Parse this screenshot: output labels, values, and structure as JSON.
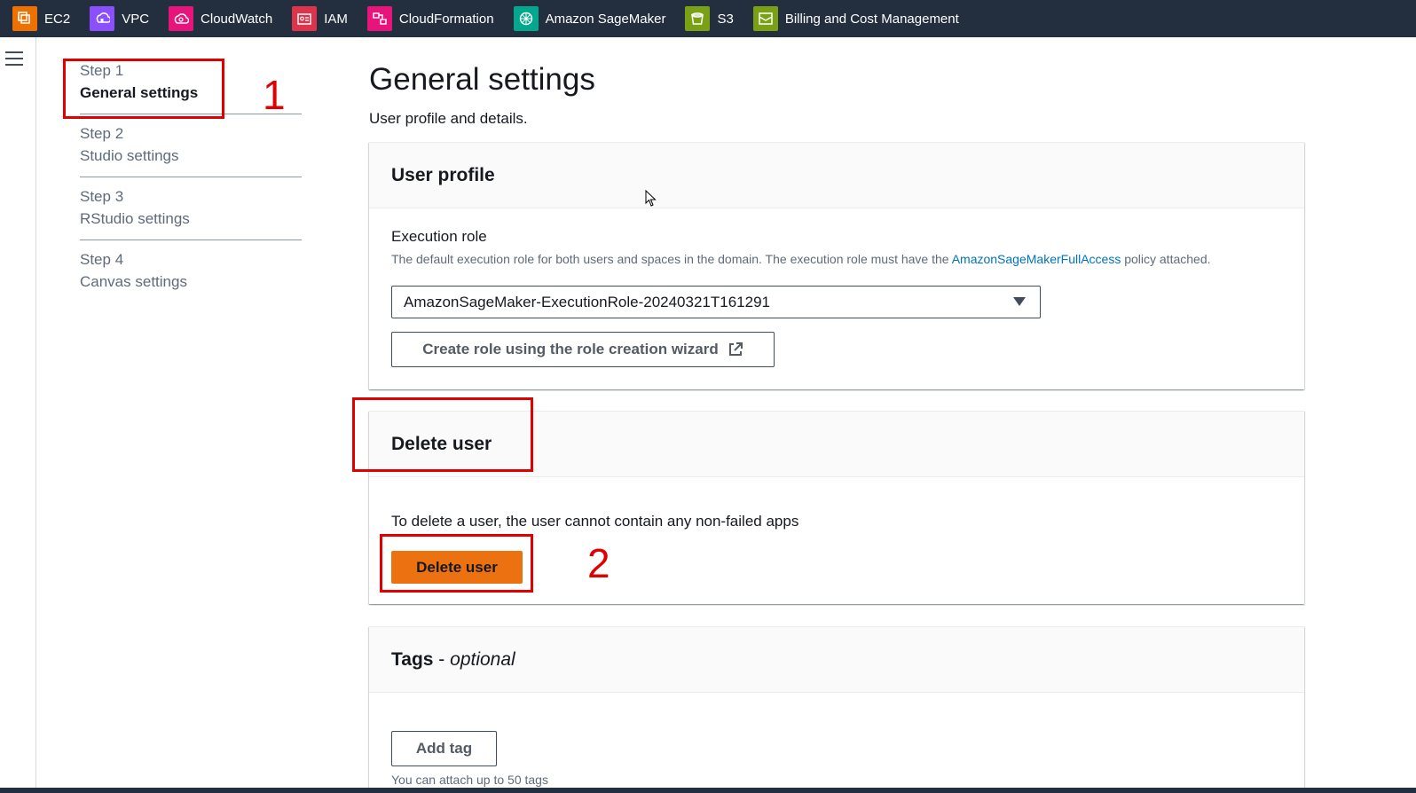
{
  "topbar": {
    "services": [
      {
        "label": "EC2",
        "icon": "ec2-icon",
        "color": "#ed7100"
      },
      {
        "label": "VPC",
        "icon": "vpc-icon",
        "color": "#8c4fff"
      },
      {
        "label": "CloudWatch",
        "icon": "cloudwatch-icon",
        "color": "#e7157b"
      },
      {
        "label": "IAM",
        "icon": "iam-icon",
        "color": "#dd344c"
      },
      {
        "label": "CloudFormation",
        "icon": "cloudformation-icon",
        "color": "#e7157b"
      },
      {
        "label": "Amazon SageMaker",
        "icon": "sagemaker-icon",
        "color": "#01a88d"
      },
      {
        "label": "S3",
        "icon": "s3-icon",
        "color": "#7aa116"
      },
      {
        "label": "Billing and Cost Management",
        "icon": "billing-icon",
        "color": "#7aa116"
      }
    ]
  },
  "steps": [
    {
      "num": "Step 1",
      "title": "General settings",
      "active": true
    },
    {
      "num": "Step 2",
      "title": "Studio settings",
      "active": false
    },
    {
      "num": "Step 3",
      "title": "RStudio settings",
      "active": false
    },
    {
      "num": "Step 4",
      "title": "Canvas settings",
      "active": false
    }
  ],
  "annotations": {
    "one": "1",
    "two": "2",
    "color": "#e00000"
  },
  "page": {
    "title": "General settings",
    "subtitle": "User profile and details."
  },
  "user_profile": {
    "header": "User profile",
    "execution_role_label": "Execution role",
    "desc_before": "The default execution role for both users and spaces in the domain. The execution role must have the ",
    "desc_link": "AmazonSageMakerFullAccess",
    "desc_after": " policy attached.",
    "selected_role": "AmazonSageMaker-ExecutionRole-20240321T161291",
    "create_role_button": "Create role using the role creation wizard"
  },
  "delete_user": {
    "header": "Delete user",
    "note": "To delete a user, the user cannot contain any non-failed apps",
    "button": "Delete user",
    "button_color": "#ec7211"
  },
  "tags": {
    "header": "Tags",
    "header_suffix": "optional",
    "dash": " - ",
    "add_button": "Add tag",
    "limit_note": "You can attach up to 50 tags"
  }
}
